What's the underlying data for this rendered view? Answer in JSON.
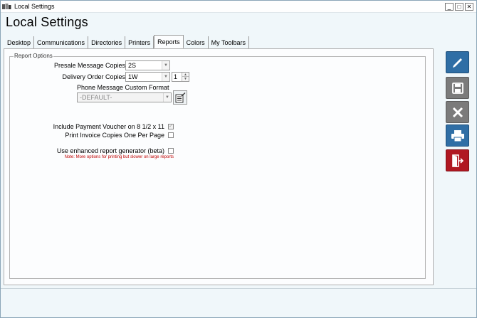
{
  "window": {
    "title": "Local Settings",
    "min_glyph": "_",
    "max_glyph": "□",
    "close_glyph": "✕"
  },
  "page_title": "Local Settings",
  "tabs": [
    {
      "label": "Desktop",
      "active": false
    },
    {
      "label": "Communications",
      "active": false
    },
    {
      "label": "Directories",
      "active": false
    },
    {
      "label": "Printers",
      "active": false
    },
    {
      "label": "Reports",
      "active": true
    },
    {
      "label": "Colors",
      "active": false
    },
    {
      "label": "My Toolbars",
      "active": false
    }
  ],
  "report_options": {
    "legend": "Report Options",
    "presale_label": "Presale Message Copies",
    "presale_value": "2S",
    "delivery_label": "Delivery Order Copies",
    "delivery_value": "1W",
    "delivery_count": "1",
    "phone_format_label": "Phone Message Custom Format",
    "phone_format_value": "-DEFAULT-",
    "voucher_label": "Include Payment Voucher on 8 1/2 x 11",
    "voucher_checked": true,
    "invoice_label": "Print Invoice Copies One Per Page",
    "invoice_checked": false,
    "enhanced_label": "Use enhanced report generator (beta)",
    "enhanced_checked": false,
    "enhanced_note": "Note: More options for printing but slower on large reports",
    "check_glyph": "✓",
    "arrow_glyph": "▼",
    "spin_up": "▲",
    "spin_down": "▼"
  },
  "toolbar": {
    "edit": "pencil-icon",
    "save": "floppy-disk-icon",
    "cancel": "x-icon",
    "print": "printer-icon",
    "exit": "exit-door-icon"
  },
  "colors": {
    "blue_button": "#2f6ea5",
    "gray_button": "#7b7b7b",
    "red_button": "#b01822",
    "note_red": "#c00000",
    "window_bg": "#f0f7fa"
  }
}
